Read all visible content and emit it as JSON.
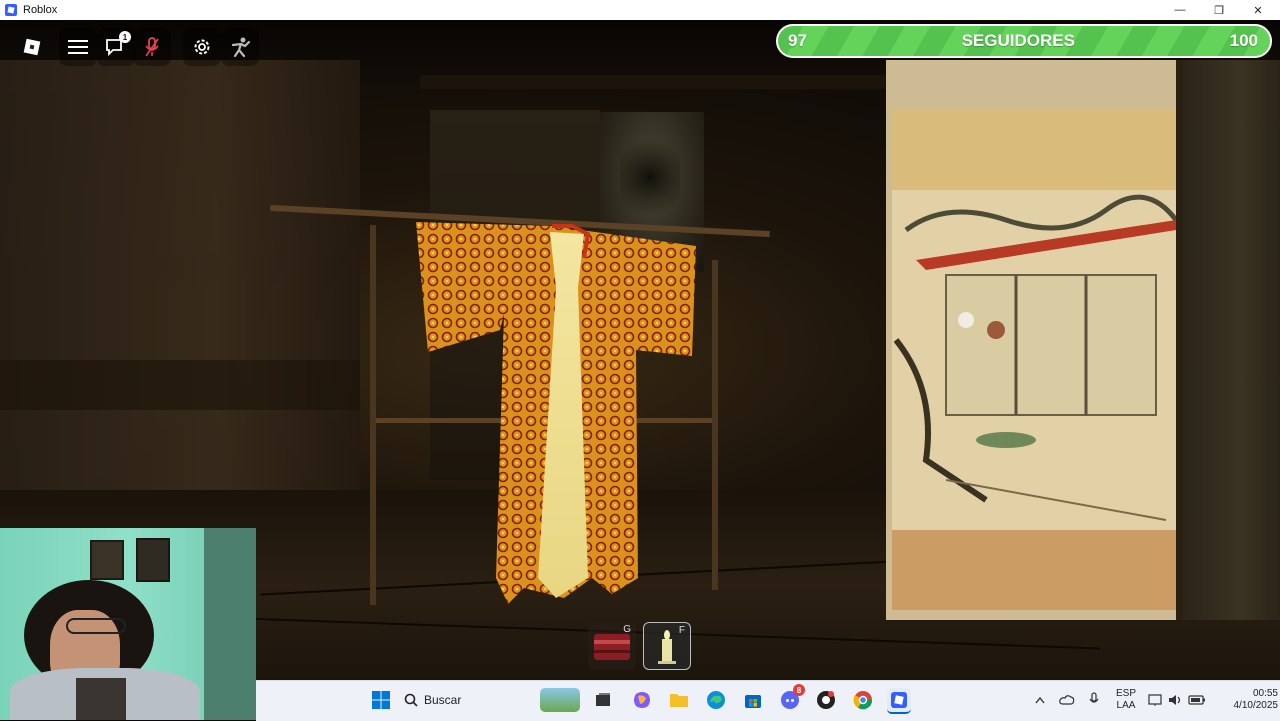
{
  "window": {
    "title": "Roblox",
    "minimize": "—",
    "maximize": "❐",
    "close": "✕"
  },
  "topbar": {
    "chat_badge": "1"
  },
  "followers": {
    "current": "97",
    "label": "SEGUIDORES",
    "goal": "100",
    "progress": 0.97,
    "color": "#5cc853"
  },
  "hotbar": [
    {
      "key": "G",
      "item": "red-box"
    },
    {
      "key": "F",
      "item": "candle"
    }
  ],
  "taskbar": {
    "search_placeholder": "Buscar",
    "language_line1": "ESP",
    "language_line2": "LAA",
    "time": "00:55",
    "date": "4/10/2025",
    "discord_badge": "8",
    "accent": "#0067c0"
  }
}
